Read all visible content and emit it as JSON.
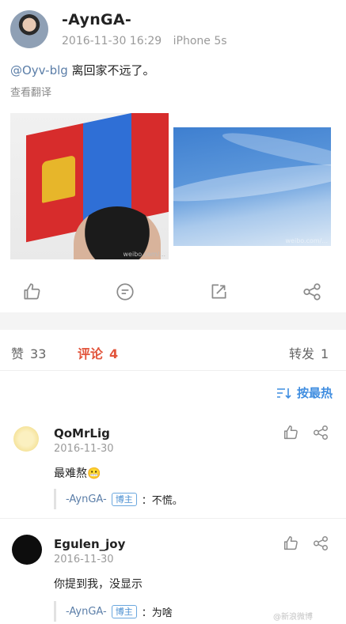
{
  "post": {
    "username": "-AynGA-",
    "datetime": "2016-11-30 16:29",
    "device": "iPhone 5s",
    "mention": "@Oyv-blg",
    "text": " 离回家不远了。",
    "translate": "查看翻译",
    "watermark1": "weibo.com/...",
    "watermark2": "weibo.com/..."
  },
  "tabs": {
    "likes": {
      "label": "赞",
      "count": "33"
    },
    "comments": {
      "label": "评论",
      "count": "4"
    },
    "reposts": {
      "label": "转发",
      "count": "1"
    }
  },
  "sort": {
    "label": "按最热"
  },
  "comments": [
    {
      "user": "QoMrLig",
      "date": "2016-11-30",
      "text": "最难熬😬",
      "reply_user": "-AynGA-",
      "reply_badge": "博主",
      "reply_text": "：不慌。",
      "avatar_color": "#f6e59c"
    },
    {
      "user": "Egulen_joy",
      "date": "2016-11-30",
      "text": "你提到我，没显示",
      "reply_user": "-AynGA-",
      "reply_badge": "博主",
      "reply_text": "：为啥",
      "avatar_color": "#0d0d0d"
    }
  ],
  "icons": [
    "like-icon",
    "comment-icon",
    "repost-icon",
    "share-icon",
    "sort-icon"
  ],
  "colors": {
    "accent": "#e2543b",
    "link": "#5b7ea8",
    "sort": "#3f8de0"
  },
  "footer_watermark": "@新浪微博"
}
